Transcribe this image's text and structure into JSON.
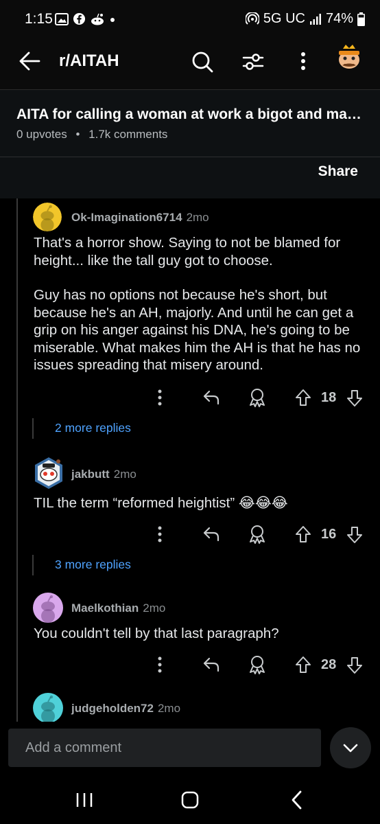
{
  "status_bar": {
    "time": "1:15",
    "network": "5G UC",
    "battery": "74%",
    "icons": [
      "gallery-icon",
      "facebook-icon",
      "reddit-icon",
      "dot-icon",
      "hotspot-icon",
      "signal-icon",
      "battery-icon"
    ]
  },
  "app_bar": {
    "title": "r/AITAH",
    "icons": [
      "back-arrow-icon",
      "search-icon",
      "sort-filter-icon",
      "overflow-menu-icon",
      "avatar-icon"
    ]
  },
  "post": {
    "title": "AITA for calling a woman at work a bigot and maki…",
    "upvotes": "0 upvotes",
    "separator": "•",
    "comments": "1.7k comments",
    "share_label": "Share"
  },
  "comments": [
    {
      "author": "Ok-Imagination6714",
      "age": "2mo",
      "avatar_color": "#f2c62a",
      "paragraphs": [
        "That's a horror show.  Saying to not be blamed for height... like the tall guy got to choose.",
        "Guy has no options not because he's short, but because he's an AH, majorly.  And until he can get a grip on his anger against his DNA, he's going to be miserable.  What makes him the AH is that he has no issues spreading that misery around."
      ],
      "votes": "18",
      "more_replies": "2 more replies"
    },
    {
      "author": "jakbutt",
      "age": "2mo",
      "avatar_color": "#3a6ea5",
      "paragraphs": [
        "TIL the term “reformed heightist” 😂😂😂"
      ],
      "votes": "16",
      "more_replies": "3 more replies"
    },
    {
      "author": "Maelkothian",
      "age": "2mo",
      "avatar_color": "#d9a8ec",
      "paragraphs": [
        "You couldn't tell by that last paragraph?"
      ],
      "votes": "28"
    },
    {
      "author": "judgeholden72",
      "age": "2mo",
      "avatar_color": "#4fd1d9",
      "paragraphs": []
    }
  ],
  "comment_input": {
    "placeholder": "Add a comment"
  },
  "colors": {
    "link": "#4fa3ff",
    "background": "#000000",
    "header_background": "#0e1113"
  }
}
